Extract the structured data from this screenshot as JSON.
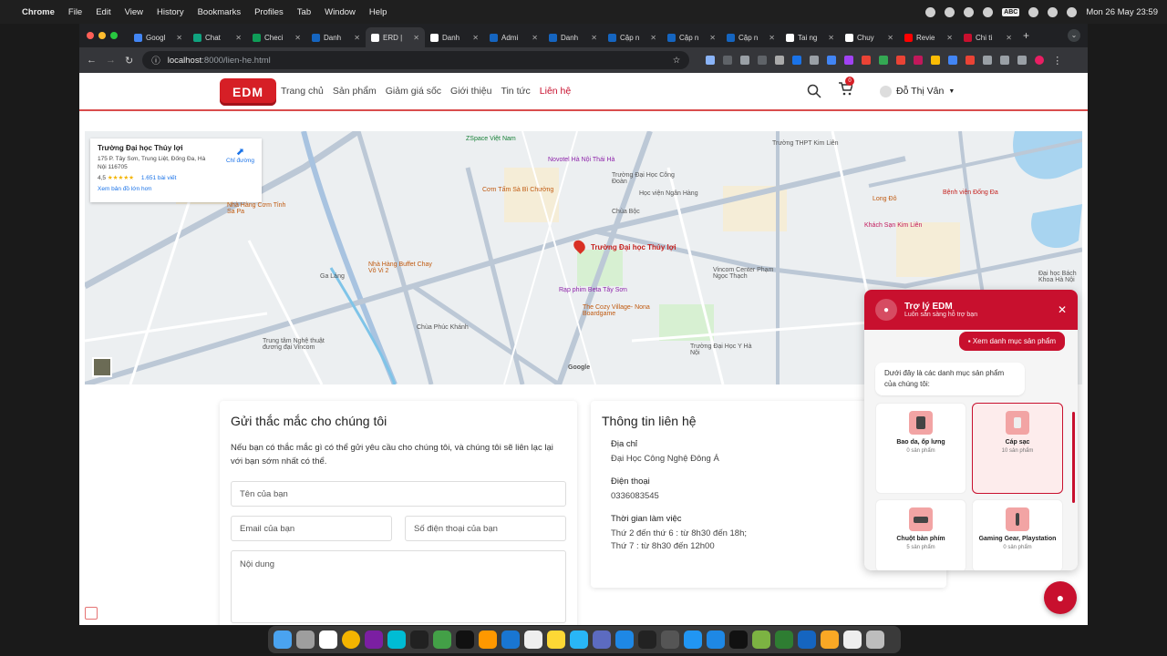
{
  "menubar": {
    "app": "Chrome",
    "items": [
      "File",
      "Edit",
      "View",
      "History",
      "Bookmarks",
      "Profiles",
      "Tab",
      "Window",
      "Help"
    ],
    "input_source": "ABC",
    "datetime": "Mon 26 May  23:59"
  },
  "tabs": [
    {
      "label": "Googl",
      "color": "#4285f4"
    },
    {
      "label": "Chat",
      "color": "#10a37f"
    },
    {
      "label": "Checi",
      "color": "#0f9d58"
    },
    {
      "label": "Danh",
      "color": "#1565c0"
    },
    {
      "label": "ERD |",
      "color": "#ffffff",
      "active": true
    },
    {
      "label": "Danh",
      "color": "#ffffff"
    },
    {
      "label": "Admi",
      "color": "#1565c0"
    },
    {
      "label": "Danh",
      "color": "#1565c0"
    },
    {
      "label": "Cập n",
      "color": "#1565c0"
    },
    {
      "label": "Cập n",
      "color": "#1565c0"
    },
    {
      "label": "Cập n",
      "color": "#1565c0"
    },
    {
      "label": "Tai ng",
      "color": "#ffffff"
    },
    {
      "label": "Chuy",
      "color": "#ffffff"
    },
    {
      "label": "Revie",
      "color": "#ff0000"
    },
    {
      "label": "Chi ti",
      "color": "#c8102e"
    }
  ],
  "address": {
    "host": "localhost",
    "path": ":8000/lien-he.html"
  },
  "site": {
    "logo": "EDM",
    "nav": [
      "Trang chủ",
      "Sản phẩm",
      "Giảm giá sốc",
      "Giới thiệu",
      "Tin tức",
      "Liên hệ"
    ],
    "cart_count": "0",
    "user_name": "Đỗ Thị Vân"
  },
  "map": {
    "card": {
      "name": "Trường Đại học Thủy lợi",
      "address": "175 P. Tây Sơn, Trung Liệt, Đống Đa, Hà Nội 116705",
      "rating": "4,5",
      "stars": "★★★★★",
      "reviews": "1.651 bài viết",
      "larger_map": "Xem bản đồ lớn hơn",
      "directions": "Chỉ đường"
    },
    "labels": {
      "main": "Trường Đại học Thủy lợi",
      "zspace": "ZSpace Việt Nam",
      "novotel": "Novotel Hà Nội Thái Hà",
      "comtam": "Cơm Tấm Sà Bì Chưởng",
      "nhahang_sapa": "Nhà Hàng Cơm Tỉnh Sa Pa",
      "buffet": "Nhà Hàng Buffet Chay Vô Vi 2",
      "beta": "Rạp phim Beta Tây Sơn",
      "cozy": "The Cozy Village- Nona Boardgame",
      "vincom": "Vincom Center Phạm Ngọc Thạch",
      "benhvien": "Bệnh viện Đống Đa",
      "khachsan": "Khách Sạn Kim Liên",
      "longdo": "Long Đô",
      "thpt": "Trường THPT Kim Liên",
      "trungtam": "Trung tâm Nghệ thuật đương đại Vincom",
      "phuckhanh": "Chùa Phúc Khánh",
      "chuabo": "Chùa Bộc",
      "yhoc": "Trường Đại Học Y Hà Nội",
      "galang": "Ga Láng",
      "congdoan": "Trường Đại Học Công Đoàn",
      "nganhang": "Học viện Ngân Hàng",
      "dhbk": "Đại học Bách Khoa Hà Nội",
      "google": "Google"
    }
  },
  "form": {
    "title": "Gửi thắc mắc cho chúng tôi",
    "description": "Nếu bạn có thắc mắc gì có thể gửi yêu cầu cho chúng tôi, và chúng tôi sẽ liên lạc lại với bạn sớm nhất có thể.",
    "name_placeholder": "Tên của bạn",
    "email_placeholder": "Email của bạn",
    "phone_placeholder": "Số điện thoại của bạn",
    "content_placeholder": "Nội dung"
  },
  "contact": {
    "title": "Thông tin liên hệ",
    "address_label": "Địa chỉ",
    "address": "Đại Học Công Nghệ Đông Á",
    "phone_label": "Điện thoại",
    "phone": "0336083545",
    "hours_label": "Thời gian làm việc",
    "hours_1": "Thứ 2 đến thứ 6 : từ 8h30 đến 18h;",
    "hours_2": "Thứ 7 : từ 8h30 đến 12h00"
  },
  "chat": {
    "title": "Trợ lý EDM",
    "subtitle": "Luôn sẵn sàng hỗ trợ bạn",
    "user_message": "Xem danh mục sản phẩm",
    "bot_message": "Dưới đây là các danh mục sản phẩm của chúng tôi:",
    "categories": [
      {
        "name": "Bao da, ốp lưng",
        "count": "0 sản phẩm"
      },
      {
        "name": "Cáp sạc",
        "count": "10 sản phẩm"
      },
      {
        "name": "Chuột bàn phím",
        "count": "5 sản phẩm"
      },
      {
        "name": "Gaming Gear, Playstation",
        "count": "0 sản phẩm"
      }
    ]
  },
  "colors": {
    "brand": "#c8102e",
    "link": "#1a73e8"
  }
}
